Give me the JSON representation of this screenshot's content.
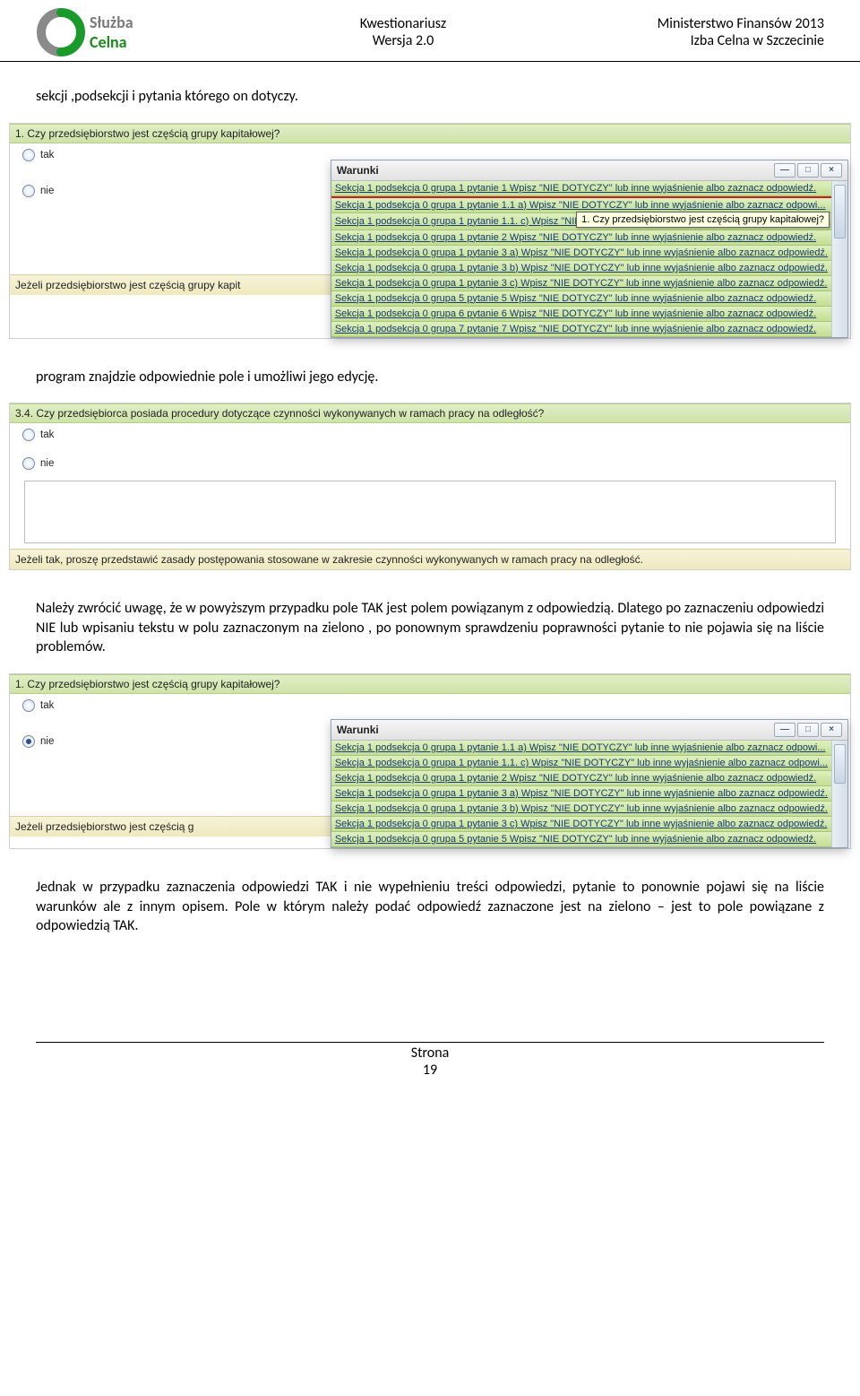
{
  "header": {
    "logo_l1": "Służba",
    "logo_l2": "Celna",
    "center_l1": "Kwestionariusz",
    "center_l2": "Wersja 2.0",
    "right_l1": "Ministerstwo Finansów 2013",
    "right_l2": "Izba Celna w Szczecinie"
  },
  "para1": "sekcji ,podsekcji i pytania którego on dotyczy.",
  "shot1": {
    "question": "1. Czy przedsiębiorstwo jest częścią grupy kapitałowej?",
    "opt_tak": "tak",
    "opt_nie": "nie",
    "instr": "Jeżeli przedsiębiorstwo jest częścią grupy kapit",
    "popup_title": "Warunki",
    "tooltip": "1. Czy przedsiębiorstwo jest częścią grupy kapitałowej?",
    "rows": [
      "Sekcja 1 podsekcja 0 grupa 1 pytanie  1 Wpisz \"NIE DOTYCZY\" lub inne wyjaśnienie albo zaznacz odpowiedź.",
      "Sekcja 1 podsekcja 0 grupa 1 pytanie  1.1 a) Wpisz \"NIE DOTYCZY\" lub inne wyjaśnienie albo zaznacz odpowi...",
      "Sekcja 1 podsekcja 0 grupa 1 pytanie  1.1. c) Wpisz \"NIE DOTYCZY\"",
      "Sekcja 1 podsekcja 0 grupa 1 pytanie  2 Wpisz \"NIE DOTYCZY\" lub inne wyjaśnienie albo zaznacz odpowiedź.",
      "Sekcja 1 podsekcja 0 grupa 1 pytanie  3 a) Wpisz \"NIE DOTYCZY\" lub inne wyjaśnienie albo zaznacz odpowiedź.",
      "Sekcja 1 podsekcja 0 grupa 1 pytanie  3 b) Wpisz \"NIE DOTYCZY\" lub inne wyjaśnienie albo zaznacz odpowiedź.",
      "Sekcja 1 podsekcja 0 grupa 1 pytanie  3 c) Wpisz \"NIE DOTYCZY\" lub inne wyjaśnienie albo zaznacz odpowiedź.",
      "Sekcja 1 podsekcja 0 grupa 5 pytanie  5 Wpisz \"NIE DOTYCZY\" lub inne wyjaśnienie albo zaznacz odpowiedź.",
      "Sekcja 1 podsekcja 0 grupa 6 pytanie  6 Wpisz \"NIE DOTYCZY\" lub inne wyjaśnienie albo zaznacz odpowiedź.",
      "Sekcja 1 podsekcja 0 grupa 7 pytanie  7 Wpisz \"NIE DOTYCZY\" lub inne wyjaśnienie albo zaznacz odpowiedź."
    ]
  },
  "para2": "program znajdzie odpowiednie pole i umożliwi jego edycję.",
  "shot2": {
    "question": "3.4. Czy przedsiębiorca posiada procedury dotyczące czynności wykonywanych w ramach pracy na odległość?",
    "opt_tak": "tak",
    "opt_nie": "nie",
    "instr": "Jeżeli tak, proszę przedstawić zasady postępowania stosowane w zakresie czynności wykonywanych w ramach pracy na odległość."
  },
  "para3": "Należy zwrócić uwagę, że w powyższym przypadku pole TAK jest polem powiązanym z odpowiedzią. Dlatego po zaznaczeniu odpowiedzi NIE lub wpisaniu tekstu w polu zaznaczonym na zielono , po ponownym sprawdzeniu poprawności pytanie to nie pojawia się na liście problemów.",
  "shot3": {
    "question": "1. Czy przedsiębiorstwo jest częścią grupy kapitałowej?",
    "opt_tak": "tak",
    "opt_nie": "nie",
    "instr": "Jeżeli przedsiębiorstwo jest częścią g",
    "popup_title": "Warunki",
    "rows": [
      "Sekcja 1 podsekcja 0 grupa 1 pytanie  1.1 a) Wpisz \"NIE DOTYCZY\" lub inne wyjaśnienie albo zaznacz odpowi...",
      "Sekcja 1 podsekcja 0 grupa 1 pytanie  1.1. c) Wpisz \"NIE DOTYCZY\" lub inne wyjaśnienie albo zaznacz odpowi...",
      "Sekcja 1 podsekcja 0 grupa 1 pytanie  2 Wpisz \"NIE DOTYCZY\" lub inne wyjaśnienie albo zaznacz odpowiedź.",
      "Sekcja 1 podsekcja 0 grupa 1 pytanie  3 a) Wpisz \"NIE DOTYCZY\" lub inne wyjaśnienie albo zaznacz odpowiedź.",
      "Sekcja 1 podsekcja 0 grupa 1 pytanie  3 b) Wpisz \"NIE DOTYCZY\" lub inne wyjaśnienie albo zaznacz odpowiedź.",
      "Sekcja 1 podsekcja 0 grupa 1 pytanie  3 c) Wpisz \"NIE DOTYCZY\" lub inne wyjaśnienie albo zaznacz odpowiedź.",
      "Sekcja 1 podsekcja 0 grupa 5 pytanie  5 Wpisz \"NIE DOTYCZY\" lub inne wyjaśnienie albo zaznacz odpowiedź."
    ]
  },
  "para4": "Jednak w przypadku zaznaczenia odpowiedzi TAK i nie wypełnieniu treści odpowiedzi, pytanie to ponownie pojawi się na liście warunków ale z innym opisem. Pole w którym należy podać odpowiedź zaznaczone jest na zielono – jest to pole powiązane z odpowiedzią TAK.",
  "footer": {
    "l1": "Strona",
    "l2": "19"
  },
  "win": {
    "min": "—",
    "max": "□",
    "close": "×"
  }
}
